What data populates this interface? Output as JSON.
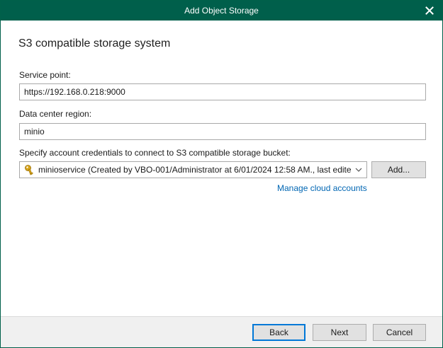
{
  "window": {
    "title": "Add Object Storage"
  },
  "page": {
    "heading": "S3 compatible storage system"
  },
  "service_point": {
    "label": "Service point:",
    "value": "https://192.168.0.218:9000"
  },
  "region": {
    "label": "Data center region:",
    "value": "minio"
  },
  "credentials": {
    "label": "Specify account credentials to connect to S3 compatible storage bucket:",
    "selected": "minioservice (Created by VBO-001/Administrator at 6/01/2024 12:58 AM., last edite",
    "icon": "key-icon",
    "add_label": "Add...",
    "manage_link": "Manage cloud accounts"
  },
  "buttons": {
    "back": "Back",
    "next": "Next",
    "cancel": "Cancel"
  },
  "colors": {
    "titlebar": "#005f4b",
    "link": "#0066b3",
    "default_button_border": "#0078d7"
  }
}
